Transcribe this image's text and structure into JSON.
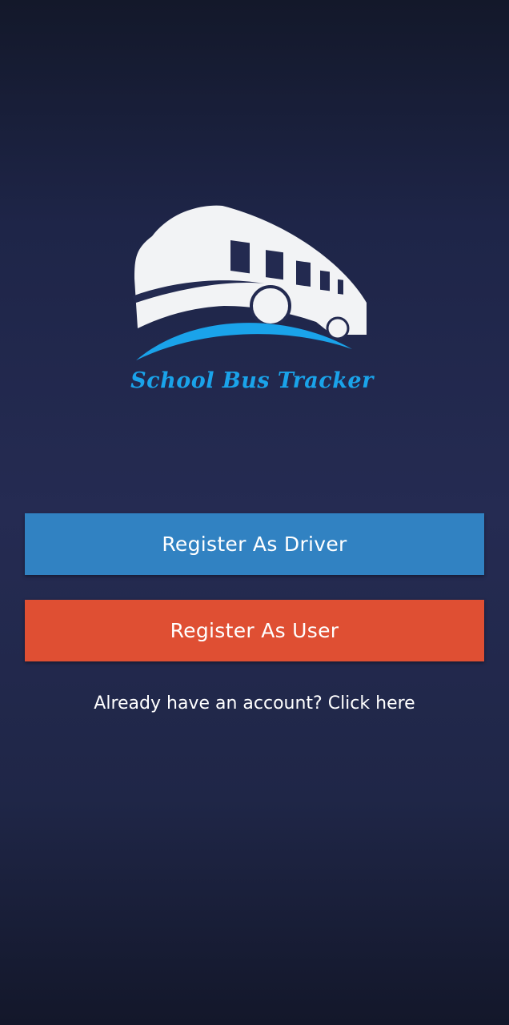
{
  "app": {
    "logo_text": "School Bus Tracker",
    "logo_icon": "bus-icon"
  },
  "actions": {
    "register_driver_label": "Register As Driver",
    "register_user_label": "Register As User",
    "login_prompt": "Already have an account? Click here"
  },
  "colors": {
    "driver_button": "#3182c2",
    "user_button": "#df4f33",
    "logo_accent": "#1aa3ea",
    "background": "#252b52"
  }
}
